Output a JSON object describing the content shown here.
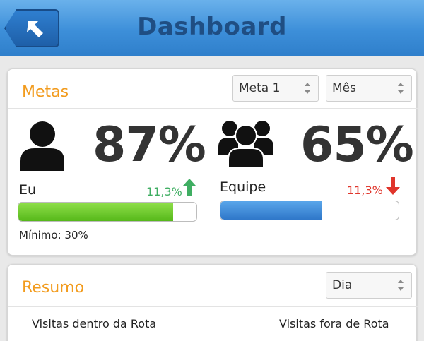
{
  "header": {
    "title": "Dashboard",
    "back_icon": "back-arrow-icon"
  },
  "metas": {
    "title": "Metas",
    "select_meta": "Meta 1",
    "select_period": "Mês",
    "eu": {
      "percent": "87%",
      "label": "Eu",
      "delta": "11,3%",
      "trend": "up",
      "progress": 0.87,
      "color": "#5cbd1d"
    },
    "equipe": {
      "percent": "65%",
      "label": "Equipe",
      "delta": "11,3%",
      "trend": "down",
      "progress": 0.57,
      "color": "#2f77c9"
    },
    "minimo": "Mínimo: 30%",
    "up_color": "#3fae62",
    "down_color": "#e0352b"
  },
  "resumo": {
    "title": "Resumo",
    "select_period": "Dia",
    "col1": "Visitas dentro da Rota",
    "col2": "Visitas fora de Rota"
  }
}
